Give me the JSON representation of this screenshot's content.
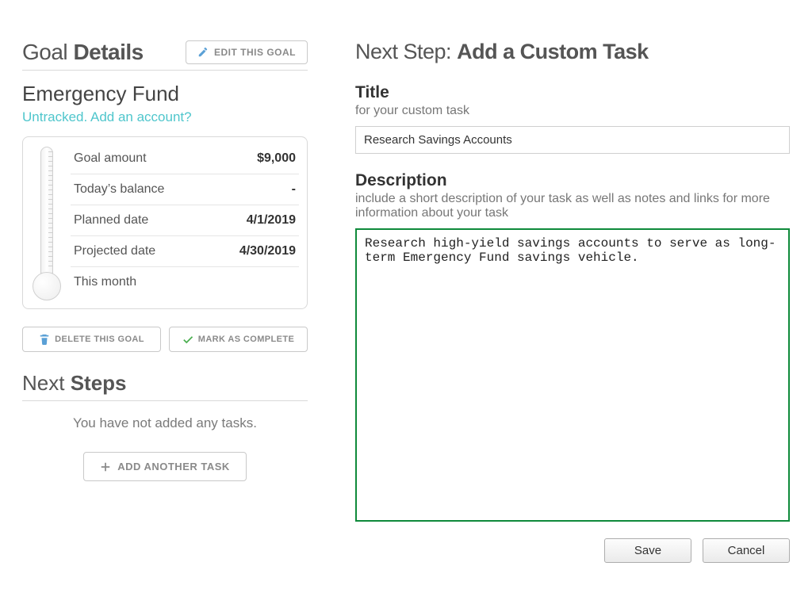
{
  "left": {
    "heading_light": "Goal ",
    "heading_bold": "Details",
    "edit_goal_label": "EDIT THIS GOAL",
    "goal_name": "Emergency Fund",
    "untracked_link": "Untracked. Add an account?",
    "stats": {
      "goal_amount_label": "Goal amount",
      "goal_amount_value": "$9,000",
      "today_balance_label": "Today’s balance",
      "today_balance_value": "-",
      "planned_date_label": "Planned date",
      "planned_date_value": "4/1/2019",
      "projected_date_label": "Projected date",
      "projected_date_value": "4/30/2019",
      "this_month_label": "This month",
      "this_month_value": ""
    },
    "delete_goal_label": "DELETE THIS GOAL",
    "mark_complete_label": "MARK AS COMPLETE",
    "next_steps_light": "Next ",
    "next_steps_bold": "Steps",
    "no_tasks_text": "You have not added any tasks.",
    "add_task_label": "ADD ANOTHER TASK"
  },
  "right": {
    "heading_light": "Next Step: ",
    "heading_bold": "Add a Custom Task",
    "title_label": "Title",
    "title_sub": "for your custom task",
    "title_value": "Research Savings Accounts",
    "desc_label": "Description",
    "desc_sub": "include a short description of your task as well as notes and links for more information about your task",
    "desc_value": "Research high-yield savings accounts to serve as long-term Emergency Fund savings vehicle.",
    "save_label": "Save",
    "cancel_label": "Cancel"
  },
  "colors": {
    "accent_teal": "#4fc6cc",
    "focus_green": "#0f8a3b"
  }
}
